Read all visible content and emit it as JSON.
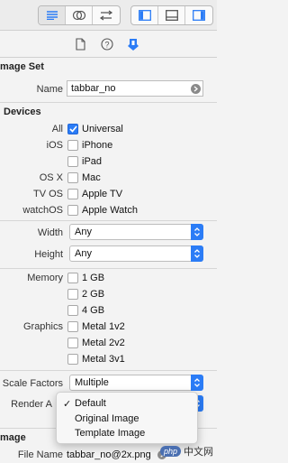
{
  "toolbar": {
    "left_group": [
      "list-icon",
      "overlap-circles-icon",
      "swap-arrows-icon"
    ],
    "right_group": [
      "left-panel-icon",
      "bottom-panel-icon",
      "right-panel-icon"
    ]
  },
  "inspector_tabs": [
    "file-inspector-icon",
    "quick-help-icon",
    "attributes-inspector-icon"
  ],
  "image_set": {
    "heading": "mage Set",
    "name_label": "Name",
    "name_value": "tabbar_no"
  },
  "devices": {
    "heading": "Devices",
    "rows": [
      {
        "label": "All",
        "option": "Universal",
        "checked": true
      },
      {
        "label": "iOS",
        "option": "iPhone",
        "checked": false
      },
      {
        "label": "",
        "option": "iPad",
        "checked": false
      },
      {
        "label": "OS X",
        "option": "Mac",
        "checked": false
      },
      {
        "label": "TV OS",
        "option": "Apple TV",
        "checked": false
      },
      {
        "label": "watchOS",
        "option": "Apple Watch",
        "checked": false
      }
    ]
  },
  "size": {
    "width_label": "Width",
    "width_value": "Any",
    "height_label": "Height",
    "height_value": "Any"
  },
  "memory": {
    "label": "Memory",
    "options": [
      "1 GB",
      "2 GB",
      "4 GB"
    ]
  },
  "graphics": {
    "label": "Graphics",
    "options": [
      "Metal 1v2",
      "Metal 2v2",
      "Metal 3v1"
    ]
  },
  "scale": {
    "label": "Scale Factors",
    "value": "Multiple"
  },
  "render": {
    "label": "Render A",
    "menu": [
      "Default",
      "Original Image",
      "Template Image"
    ],
    "selected": "Default",
    "checkmark": "✓"
  },
  "image": {
    "heading": "mage",
    "file_label": "File Name",
    "file_value": "tabbar_no@2x.png"
  },
  "watermark": {
    "text": "中文网",
    "badge": "php"
  },
  "colors": {
    "accent": "#2b7cf6"
  }
}
